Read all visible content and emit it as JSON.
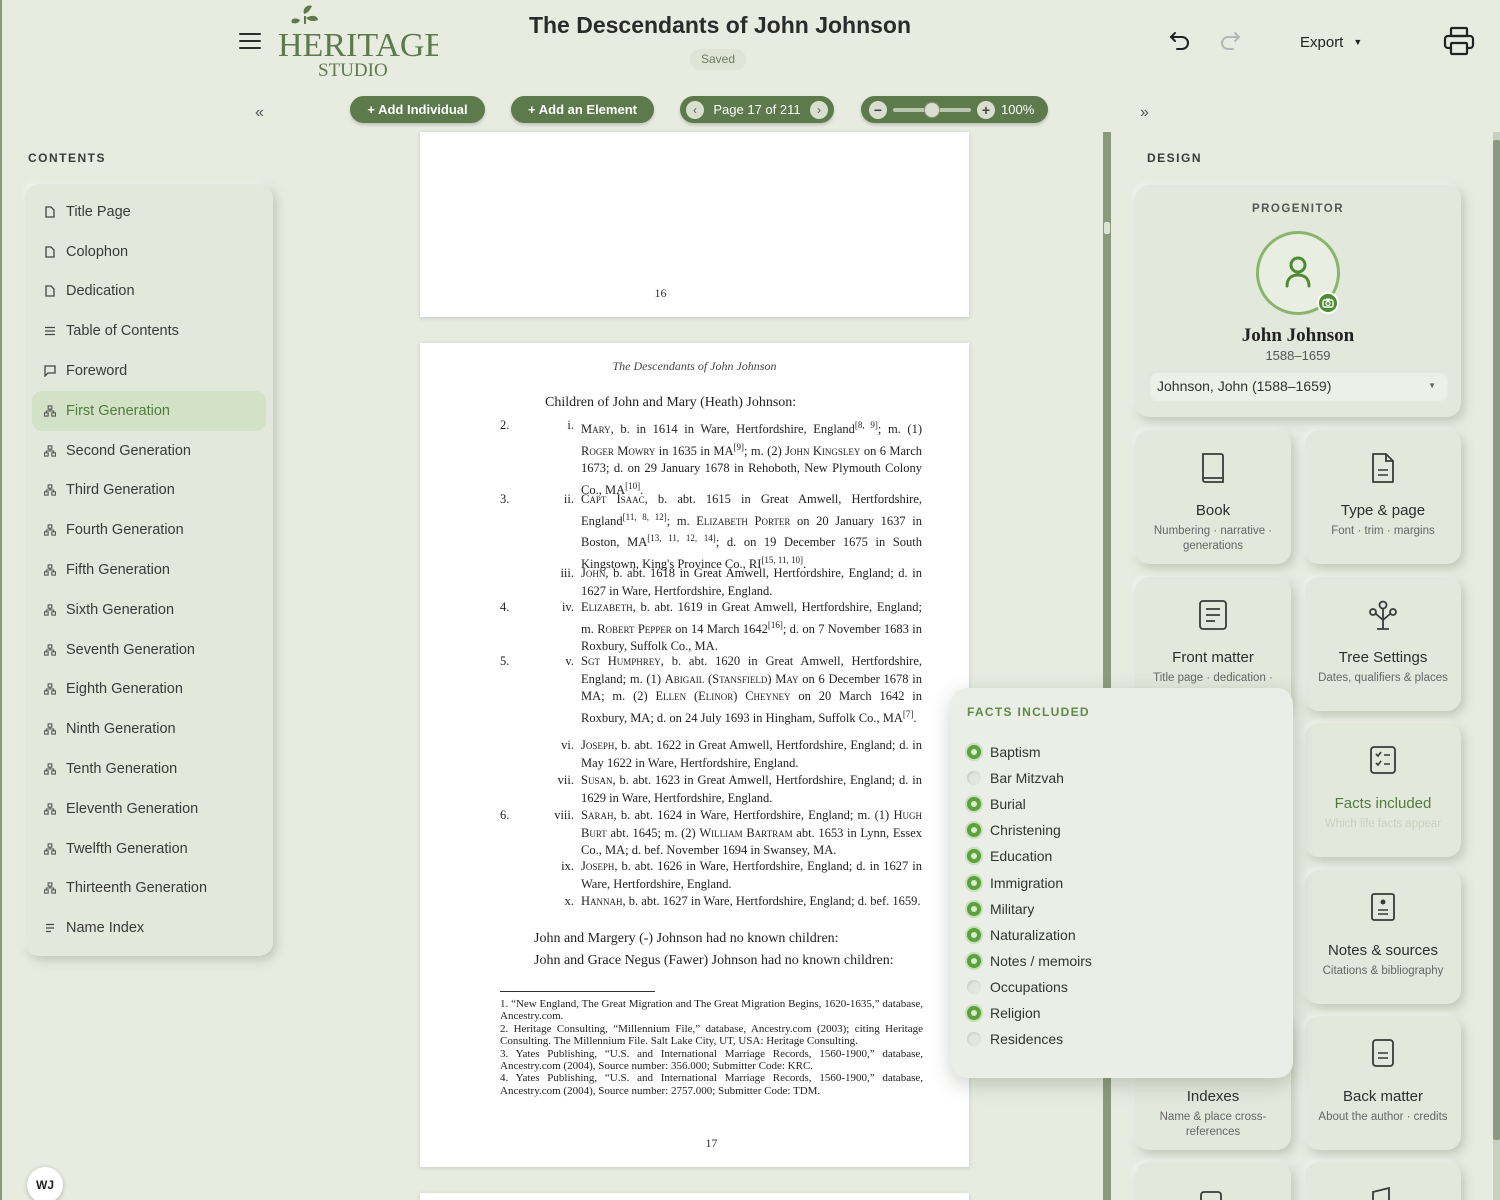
{
  "app": {
    "logo_line1": "HERITAGE",
    "logo_line2": "STUDIO",
    "document_title": "The Descendants of John Johnson",
    "save_status": "Saved",
    "export_label": "Export",
    "user_initials": "WJ",
    "accent_color": "#5d7a4c",
    "highlight_color": "#5aa23c"
  },
  "toolbar": {
    "add_individual": "+ Add Individual",
    "add_element": "+ Add an Element",
    "page_indicator": "Page 17 of 211",
    "zoom_value": "100%",
    "zoom_level": 0.5
  },
  "contents": {
    "heading": "CONTENTS",
    "items": [
      {
        "label": "Title Page",
        "icon": "page-icon"
      },
      {
        "label": "Colophon",
        "icon": "page-icon"
      },
      {
        "label": "Dedication",
        "icon": "page-icon"
      },
      {
        "label": "Table of Contents",
        "icon": "list-icon"
      },
      {
        "label": "Foreword",
        "icon": "comment-icon"
      },
      {
        "label": "First Generation",
        "icon": "tree-icon",
        "active": true
      },
      {
        "label": "Second Generation",
        "icon": "tree-icon"
      },
      {
        "label": "Third Generation",
        "icon": "tree-icon"
      },
      {
        "label": "Fourth Generation",
        "icon": "tree-icon"
      },
      {
        "label": "Fifth Generation",
        "icon": "tree-icon"
      },
      {
        "label": "Sixth Generation",
        "icon": "tree-icon"
      },
      {
        "label": "Seventh Generation",
        "icon": "tree-icon"
      },
      {
        "label": "Eighth Generation",
        "icon": "tree-icon"
      },
      {
        "label": "Ninth Generation",
        "icon": "tree-icon"
      },
      {
        "label": "Tenth Generation",
        "icon": "tree-icon"
      },
      {
        "label": "Eleventh Generation",
        "icon": "tree-icon"
      },
      {
        "label": "Twelfth Generation",
        "icon": "tree-icon"
      },
      {
        "label": "Thirteenth Generation",
        "icon": "tree-icon"
      },
      {
        "label": "Name Index",
        "icon": "index-icon"
      }
    ]
  },
  "pages": {
    "prev_page_number": "16",
    "current": {
      "running_head": "The Descendants of John Johnson",
      "children_heading": "Children of John and Mary (Heath) Johnson:",
      "closing_1": "John and Margery (-) Johnson had no known children:",
      "closing_2": "John and Grace Negus (Fawer) Johnson had no known children:",
      "page_number": "17",
      "footnotes": [
        "1. “New England, The Great Migration and The Great Migration Begins, 1620-1635,” database, Ancestry.com.",
        "2. Heritage Consulting, “Millennium File,” database, Ancestry.com (2003); citing Heritage Consulting. The Millennium File. Salt Lake City, UT, USA: Heritage Consulting.",
        "3. Yates Publishing, “U.S. and International Marriage Records, 1560-1900,” database, Ancestry.com (2004), Source number: 356.000; Submitter Code: KRC.",
        "4. Yates Publishing, “U.S. and International Marriage Records, 1560-1900,” database, Ancestry.com (2004), Source number: 2757.000; Submitter Code: TDM."
      ]
    }
  },
  "design": {
    "heading": "DESIGN",
    "progenitor_label": "PROGENITOR",
    "progenitor_name": "John Johnson",
    "progenitor_dates": "1588–1659",
    "progenitor_select": "Johnson, John (1588–1659)",
    "cards": {
      "book": {
        "title": "Book",
        "sub": "Numbering · narrative · generations"
      },
      "type": {
        "title": "Type & page",
        "sub": "Font · trim · margins"
      },
      "front": {
        "title": "Front matter",
        "sub": "Title page · dedication ·"
      },
      "tree": {
        "title": "Tree Settings",
        "sub": "Dates, qualifiers & places"
      },
      "facts": {
        "title": "Facts included",
        "sub": "Which life facts appear"
      },
      "notes": {
        "title": "Notes & sources",
        "sub": "Citations & bibliography"
      },
      "index": {
        "title": "Indexes",
        "sub": "Name & place cross-references"
      },
      "back": {
        "title": "Back matter",
        "sub": "About the author · credits"
      }
    }
  },
  "facts_popover": {
    "title": "FACTS INCLUDED",
    "items": [
      {
        "label": "Baptism",
        "on": true
      },
      {
        "label": "Bar Mitzvah",
        "on": false
      },
      {
        "label": "Burial",
        "on": true
      },
      {
        "label": "Christening",
        "on": true
      },
      {
        "label": "Education",
        "on": true
      },
      {
        "label": "Immigration",
        "on": true
      },
      {
        "label": "Military",
        "on": true
      },
      {
        "label": "Naturalization",
        "on": true
      },
      {
        "label": "Notes / memoirs",
        "on": true
      },
      {
        "label": "Occupations",
        "on": false
      },
      {
        "label": "Religion",
        "on": true
      },
      {
        "label": "Residences",
        "on": false
      }
    ]
  },
  "entries": [
    {
      "num": "2.",
      "rom": "i.",
      "parts": [
        [
          "sc",
          "Mary"
        ],
        [
          "t",
          ", b. in 1614 in Ware, Hertfordshire, England"
        ],
        [
          "sup",
          "[8, 9]"
        ],
        [
          "t",
          "; m. (1) "
        ],
        [
          "sc",
          "Roger Mowry"
        ],
        [
          "t",
          " in 1635 in MA"
        ],
        [
          "sup",
          "[9]"
        ],
        [
          "t",
          "; m. (2) "
        ],
        [
          "sc",
          "John Kingsley"
        ],
        [
          "t",
          " on 6 March 1673; d. on 29 January 1678 in Rehoboth, New Plymouth Colony Co., MA"
        ],
        [
          "sup",
          "[10]"
        ],
        [
          "t",
          "."
        ]
      ]
    },
    {
      "num": "3.",
      "rom": "ii.",
      "parts": [
        [
          "sc",
          "Capt Isaac"
        ],
        [
          "t",
          ", b. abt. 1615 in Great Amwell, Hertfordshire, England"
        ],
        [
          "sup",
          "[11, 8, 12]"
        ],
        [
          "t",
          "; m. "
        ],
        [
          "sc",
          "Elizabeth Porter"
        ],
        [
          "t",
          " on 20 January 1637 in Boston, MA"
        ],
        [
          "sup",
          "[13, 11, 12, 14]"
        ],
        [
          "t",
          "; d. on 19 December 1675 in South Kingstown, King's Province Co., RI"
        ],
        [
          "sup",
          "[15, 11, 10]"
        ],
        [
          "t",
          "."
        ]
      ]
    },
    {
      "num": "",
      "rom": "iii.",
      "parts": [
        [
          "sc",
          "John"
        ],
        [
          "t",
          ", b. abt. 1618 in Great Amwell, Hertfordshire, England; d. in 1627 in Ware, Hertfordshire, England."
        ]
      ]
    },
    {
      "num": "4.",
      "rom": "iv.",
      "parts": [
        [
          "sc",
          "Elizabeth"
        ],
        [
          "t",
          ", b. abt. 1619 in Great Amwell, Hertfordshire, England; m. "
        ],
        [
          "sc",
          "Robert Pepper"
        ],
        [
          "t",
          " on 14 March 1642"
        ],
        [
          "sup",
          "[16]"
        ],
        [
          "t",
          "; d. on 7 November 1683 in Roxbury, Suffolk Co., MA."
        ]
      ]
    },
    {
      "num": "5.",
      "rom": "v.",
      "parts": [
        [
          "sc",
          "Sgt Humphrey"
        ],
        [
          "t",
          ", b. abt. 1620 in Great Amwell, Hertfordshire, England; m. (1) "
        ],
        [
          "sc",
          "Abigail (Stansfield) May"
        ],
        [
          "t",
          " on 6 December 1678 in MA; m. (2) "
        ],
        [
          "sc",
          "Ellen (Elinor) Cheyney"
        ],
        [
          "t",
          " on 20 March 1642 in Roxbury, MA; d. on 24 July 1693 in Hingham, Suffolk Co., MA"
        ],
        [
          "sup",
          "[7]"
        ],
        [
          "t",
          "."
        ]
      ]
    },
    {
      "num": "",
      "rom": "vi.",
      "parts": [
        [
          "sc",
          "Joseph"
        ],
        [
          "t",
          ", b. abt. 1622 in Great Amwell, Hertfordshire, England; d. in May 1622 in Ware, Hertfordshire, England."
        ]
      ]
    },
    {
      "num": "",
      "rom": "vii.",
      "parts": [
        [
          "sc",
          "Susan"
        ],
        [
          "t",
          ", b. abt. 1623 in Great Amwell, Hertfordshire, England; d. in 1629 in Ware, Hertfordshire, England."
        ]
      ]
    },
    {
      "num": "6.",
      "rom": "viii.",
      "parts": [
        [
          "sc",
          "Sarah"
        ],
        [
          "t",
          ", b. abt. 1624 in Ware, Hertfordshire, England; m. (1) "
        ],
        [
          "sc",
          "Hugh Burt"
        ],
        [
          "t",
          " abt. 1645; m. (2) "
        ],
        [
          "sc",
          "William Bartram"
        ],
        [
          "t",
          " abt. 1653 in Lynn, Essex Co., MA; d. bef. November 1694 in Swansey, MA."
        ]
      ]
    },
    {
      "num": "",
      "rom": "ix.",
      "parts": [
        [
          "sc",
          "Joseph"
        ],
        [
          "t",
          ", b. abt. 1626 in Ware, Hertfordshire, England; d. in 1627 in Ware, Hertfordshire, England."
        ]
      ]
    },
    {
      "num": "",
      "rom": "x.",
      "parts": [
        [
          "sc",
          "Hannah"
        ],
        [
          "t",
          ", b. abt. 1627 in Ware, Hertfordshire, England; d. bef. 1659."
        ]
      ]
    }
  ]
}
